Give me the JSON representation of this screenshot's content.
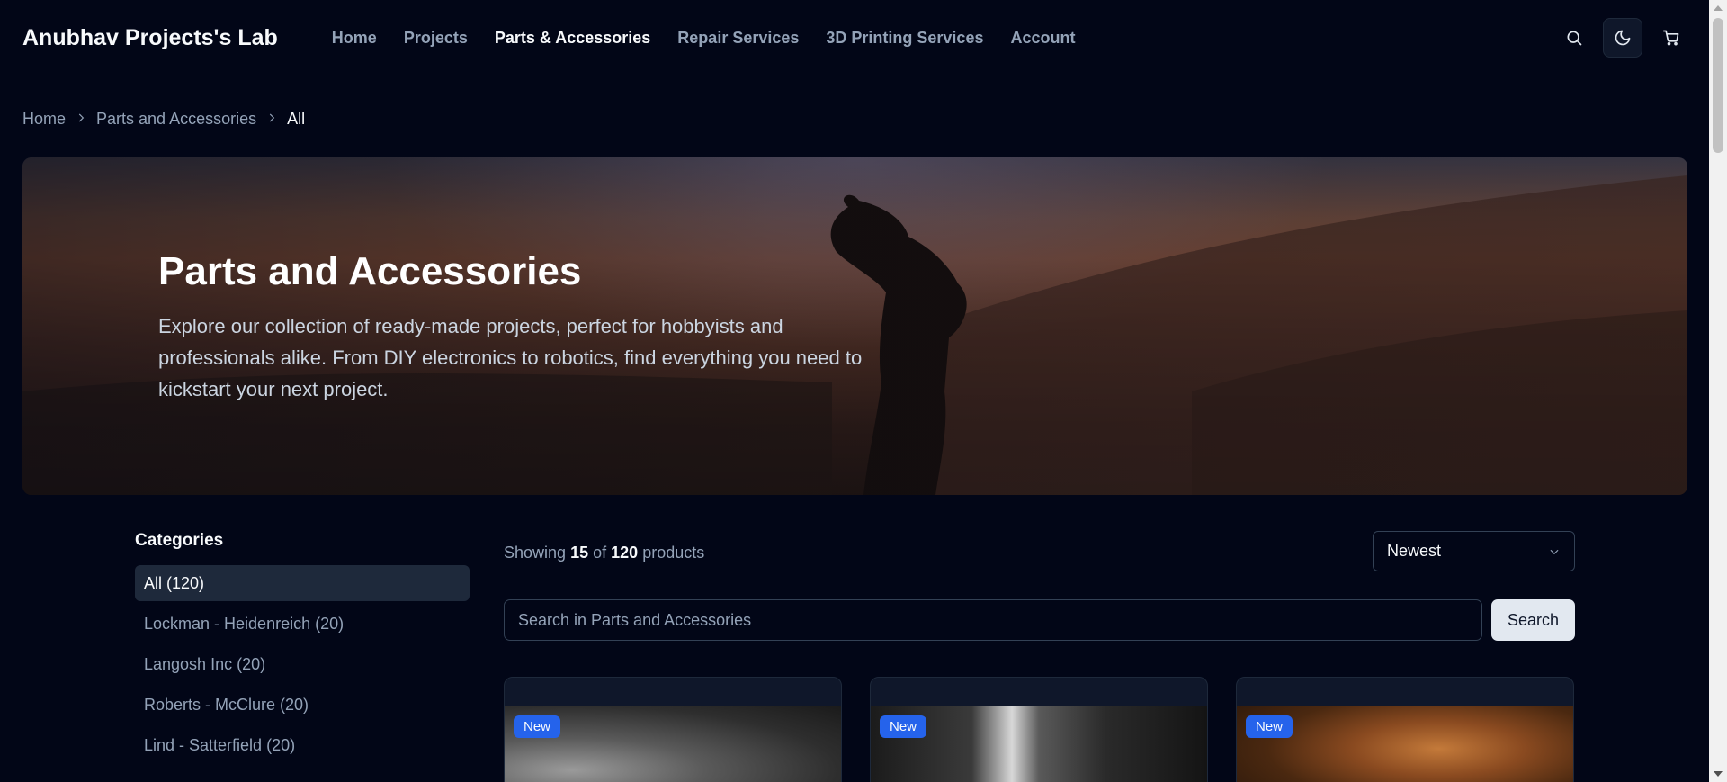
{
  "header": {
    "brand": "Anubhav Projects's Lab",
    "nav": [
      {
        "label": "Home",
        "active": false
      },
      {
        "label": "Projects",
        "active": false
      },
      {
        "label": "Parts & Accessories",
        "active": true
      },
      {
        "label": "Repair Services",
        "active": false
      },
      {
        "label": "3D Printing Services",
        "active": false
      },
      {
        "label": "Account",
        "active": false
      }
    ],
    "icons": {
      "search": "search-icon",
      "theme": "moon-icon",
      "cart": "cart-icon"
    }
  },
  "breadcrumb": [
    {
      "label": "Home"
    },
    {
      "label": "Parts and Accessories"
    },
    {
      "label": "All"
    }
  ],
  "hero": {
    "title": "Parts and Accessories",
    "description": "Explore our collection of ready-made projects, perfect for hobbyists and professionals alike. From DIY electronics to robotics, find everything you need to kickstart your next project."
  },
  "sidebar": {
    "title": "Categories",
    "items": [
      {
        "label": "All (120)",
        "active": true
      },
      {
        "label": "Lockman - Heidenreich (20)",
        "active": false
      },
      {
        "label": "Langosh Inc (20)",
        "active": false
      },
      {
        "label": "Roberts - McClure (20)",
        "active": false
      },
      {
        "label": "Lind - Satterfield (20)",
        "active": false
      }
    ]
  },
  "main": {
    "showing_prefix": "Showing",
    "showing_count": "15",
    "showing_of": "of",
    "showing_total": "120",
    "showing_suffix": "products",
    "sort_value": "Newest",
    "search_placeholder": "Search in Parts and Accessories",
    "search_button": "Search",
    "cards": [
      {
        "badge": "New"
      },
      {
        "badge": "New"
      },
      {
        "badge": "New"
      }
    ]
  },
  "colors": {
    "background": "#020617",
    "accent": "#2563eb",
    "muted_text": "#94a3b8"
  }
}
